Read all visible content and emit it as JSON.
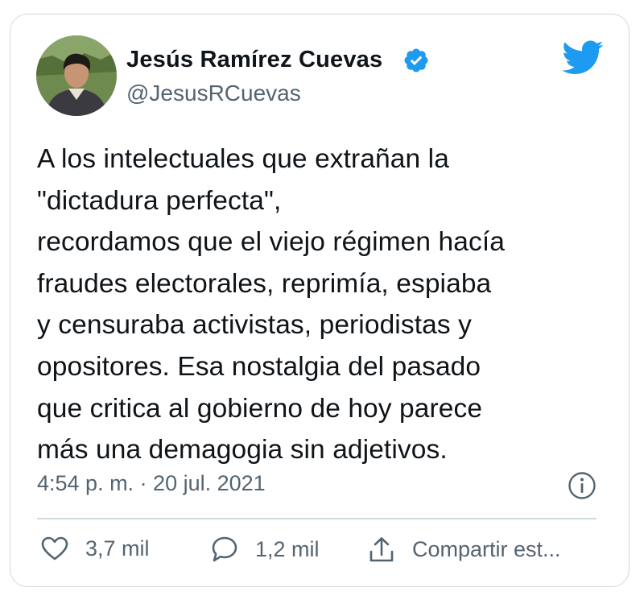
{
  "author": {
    "name": "Jesús Ramírez Cuevas",
    "handle": "@JesusRCuevas"
  },
  "tweet": {
    "text": "A los intelectuales que extrañan la\n\"dictadura perfecta\",\nrecordamos que el viejo régimen hacía\nfraudes electorales, reprimía, espiaba\ny censuraba activistas, periodistas y\nopositores. Esa nostalgia del pasado\nque critica al gobierno de hoy parece\nmás una demagogia sin adjetivos.",
    "timestamp": "4:54 p. m. · 20 jul. 2021"
  },
  "actions": {
    "likes": "3,7 mil",
    "replies": "1,2 mil",
    "share": "Compartir est..."
  },
  "icons": {
    "verified": "verified-badge-icon",
    "bird": "twitter-bird-icon",
    "info": "info-icon",
    "like": "heart-icon",
    "reply": "speech-bubble-icon",
    "share": "share-icon"
  },
  "colors": {
    "brand": "#1d9bf0",
    "secondary_text": "#536471",
    "border": "#cfd9de"
  }
}
